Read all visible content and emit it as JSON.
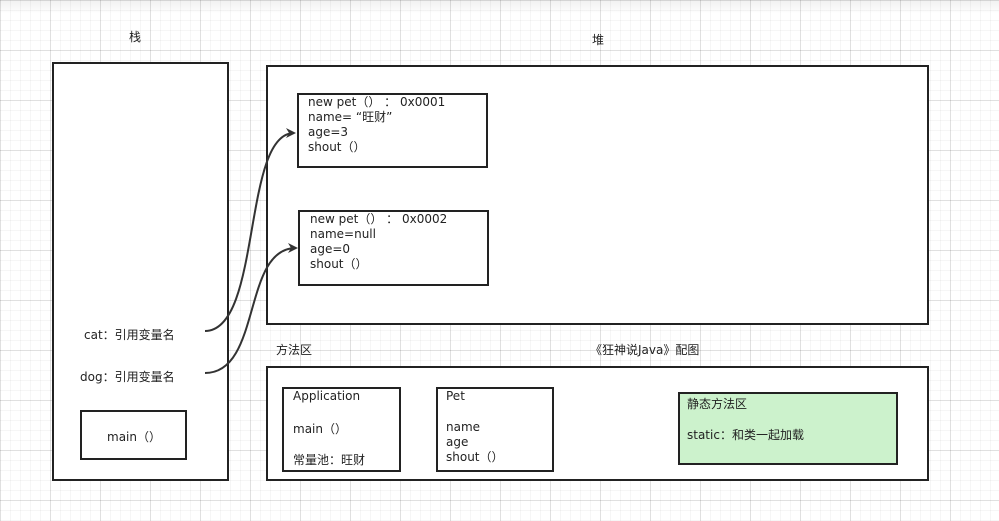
{
  "stack": {
    "title": "栈",
    "cat_ref": "cat：引用变量名",
    "dog_ref": "dog：引用变量名",
    "main": "main（）"
  },
  "heap": {
    "title": "堆",
    "obj1": {
      "header": "new pet（）  ：  0x0001",
      "name": "name= “旺财”",
      "age": "age=3",
      "shout": "shout（）"
    },
    "obj2": {
      "header": "new pet（）  ：  0x0002",
      "name": "name=null",
      "age": "age=0",
      "shout": "shout（）"
    }
  },
  "method_area": {
    "title": "方法区",
    "caption": "《狂神说Java》配图",
    "application": {
      "title": "Application",
      "main": "main（）",
      "constant_pool": "常量池：旺财"
    },
    "pet": {
      "title": "Pet",
      "name": "name",
      "age": "age",
      "shout": "shout（）"
    },
    "static_area": {
      "title": "静态方法区",
      "text": "static：和类一起加载",
      "color": "#ccf2cc"
    }
  }
}
